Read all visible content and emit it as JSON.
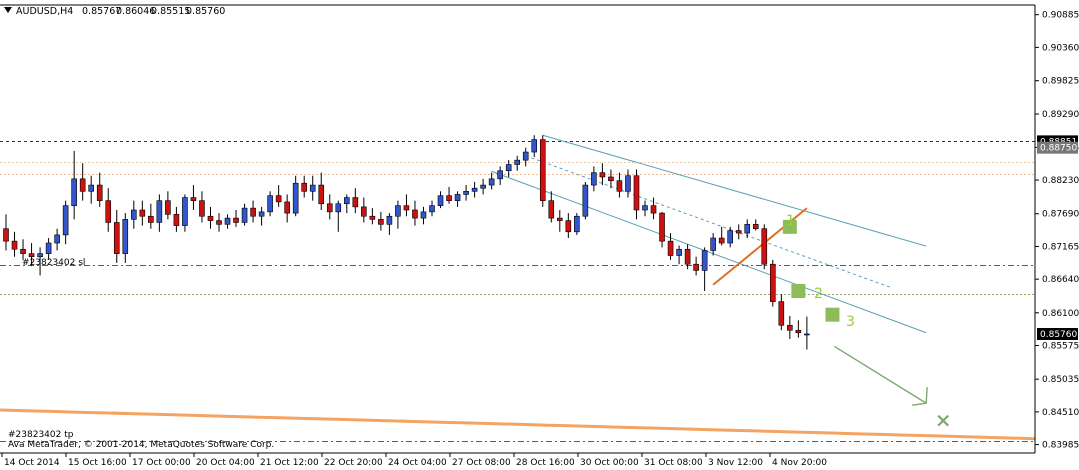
{
  "header": {
    "symbol": "AUDUSD,H4",
    "open": "0.85767",
    "high": "0.86046",
    "low": "0.85515",
    "close": "0.85760"
  },
  "footer": {
    "broker": "Ava MetaTrader, © 2001-2014, MetaQuotes Software Corp."
  },
  "labels": {
    "sl_label": "#23823402 sl",
    "tp_label": "#23823402 tp"
  },
  "annotations": [
    {
      "text": "1"
    },
    {
      "text": "2"
    },
    {
      "text": "3"
    }
  ],
  "colors": {
    "bull": "#3355cc",
    "bear": "#cc1111",
    "resistance": "#990000",
    "sl": "#dd2222",
    "orange": "#f4a460",
    "trendline": "#e07020",
    "channel": "#5aa0b8",
    "green": "#8fbc5a",
    "annotation": "#9acd32"
  },
  "chart_data": {
    "type": "candlestick",
    "y_ticks": [
      "0.90885",
      "0.90360",
      "0.89825",
      "0.89290",
      "0.88755",
      "0.88230",
      "0.87690",
      "0.87165",
      "0.86640",
      "0.86100",
      "0.85575",
      "0.85035",
      "0.84510",
      "0.83985"
    ],
    "x_ticks": [
      "14 Oct 2014",
      "15 Oct 16:00",
      "17 Oct 00:00",
      "20 Oct 04:00",
      "21 Oct 12:00",
      "22 Oct 20:00",
      "24 Oct 04:00",
      "27 Oct 08:00",
      "28 Oct 16:00",
      "30 Oct 00:00",
      "31 Oct 08:00",
      "3 Nov 12:00",
      "4 Nov 20:00"
    ],
    "ylim": [
      0.8385,
      0.9104
    ],
    "price_tags": [
      {
        "label": "0.88851",
        "value": 0.88851,
        "style": "dark"
      },
      {
        "label": "0.88750",
        "value": 0.8875,
        "style": "light"
      },
      {
        "label": "0.85760",
        "value": 0.8576,
        "style": "dark"
      }
    ],
    "levels": [
      {
        "name": "resistance",
        "value": 0.88851
      },
      {
        "name": "stop-loss",
        "value": 0.8687
      },
      {
        "name": "support",
        "value": 0.864
      },
      {
        "name": "take-profit",
        "value": 0.8405
      },
      {
        "name": "upper-reference",
        "value": 0.88525
      },
      {
        "name": "dotted-reference",
        "value": 0.8832
      }
    ],
    "candles": [
      [
        0.8745,
        0.8768,
        0.871,
        0.8725
      ],
      [
        0.8725,
        0.874,
        0.87,
        0.8712
      ],
      [
        0.8712,
        0.8728,
        0.8695,
        0.8705
      ],
      [
        0.8705,
        0.8722,
        0.8685,
        0.87
      ],
      [
        0.87,
        0.8715,
        0.867,
        0.8705
      ],
      [
        0.8705,
        0.873,
        0.8695,
        0.8722
      ],
      [
        0.8722,
        0.8745,
        0.871,
        0.8735
      ],
      [
        0.8735,
        0.879,
        0.872,
        0.8782
      ],
      [
        0.8782,
        0.887,
        0.876,
        0.8825
      ],
      [
        0.8825,
        0.885,
        0.879,
        0.8805
      ],
      [
        0.8805,
        0.883,
        0.8785,
        0.8815
      ],
      [
        0.8815,
        0.8835,
        0.878,
        0.879
      ],
      [
        0.879,
        0.881,
        0.874,
        0.8755
      ],
      [
        0.8755,
        0.8775,
        0.869,
        0.8705
      ],
      [
        0.8705,
        0.877,
        0.869,
        0.876
      ],
      [
        0.876,
        0.879,
        0.8745,
        0.8775
      ],
      [
        0.8775,
        0.879,
        0.875,
        0.8765
      ],
      [
        0.8765,
        0.8785,
        0.8745,
        0.8755
      ],
      [
        0.8755,
        0.88,
        0.874,
        0.879
      ],
      [
        0.879,
        0.8805,
        0.876,
        0.8768
      ],
      [
        0.8768,
        0.878,
        0.874,
        0.875
      ],
      [
        0.875,
        0.88,
        0.874,
        0.8795
      ],
      [
        0.8795,
        0.8815,
        0.8775,
        0.879
      ],
      [
        0.879,
        0.8805,
        0.8755,
        0.8765
      ],
      [
        0.8765,
        0.878,
        0.8745,
        0.8758
      ],
      [
        0.8758,
        0.877,
        0.874,
        0.8752
      ],
      [
        0.8752,
        0.8768,
        0.8745,
        0.8762
      ],
      [
        0.8762,
        0.8775,
        0.8748,
        0.8755
      ],
      [
        0.8755,
        0.8785,
        0.875,
        0.8778
      ],
      [
        0.8778,
        0.879,
        0.8755,
        0.8765
      ],
      [
        0.8765,
        0.878,
        0.875,
        0.8772
      ],
      [
        0.8772,
        0.8805,
        0.8765,
        0.8798
      ],
      [
        0.8798,
        0.8815,
        0.878,
        0.8788
      ],
      [
        0.8788,
        0.88,
        0.8755,
        0.877
      ],
      [
        0.877,
        0.883,
        0.8765,
        0.8818
      ],
      [
        0.8818,
        0.883,
        0.8795,
        0.8805
      ],
      [
        0.8805,
        0.883,
        0.879,
        0.8815
      ],
      [
        0.8815,
        0.8835,
        0.8775,
        0.8785
      ],
      [
        0.8785,
        0.88,
        0.876,
        0.8772
      ],
      [
        0.8772,
        0.879,
        0.874,
        0.8785
      ],
      [
        0.8785,
        0.88,
        0.877,
        0.8795
      ],
      [
        0.8795,
        0.881,
        0.877,
        0.878
      ],
      [
        0.878,
        0.8795,
        0.8755,
        0.8765
      ],
      [
        0.8765,
        0.8778,
        0.8752,
        0.876
      ],
      [
        0.876,
        0.8772,
        0.8742,
        0.8752
      ],
      [
        0.8752,
        0.877,
        0.8735,
        0.8765
      ],
      [
        0.8765,
        0.879,
        0.8745,
        0.8782
      ],
      [
        0.8782,
        0.88,
        0.8765,
        0.8775
      ],
      [
        0.8775,
        0.879,
        0.875,
        0.8762
      ],
      [
        0.8762,
        0.878,
        0.8752,
        0.8772
      ],
      [
        0.8772,
        0.879,
        0.8765,
        0.8782
      ],
      [
        0.8782,
        0.8805,
        0.8778,
        0.8798
      ],
      [
        0.8798,
        0.8812,
        0.8785,
        0.879
      ],
      [
        0.879,
        0.8805,
        0.878,
        0.88
      ],
      [
        0.88,
        0.8815,
        0.879,
        0.8805
      ],
      [
        0.8805,
        0.882,
        0.8795,
        0.881
      ],
      [
        0.881,
        0.8825,
        0.88,
        0.8815
      ],
      [
        0.8815,
        0.8835,
        0.8808,
        0.8825
      ],
      [
        0.8825,
        0.8845,
        0.8815,
        0.8838
      ],
      [
        0.8838,
        0.8855,
        0.8828,
        0.8848
      ],
      [
        0.8848,
        0.8862,
        0.8838,
        0.8855
      ],
      [
        0.8855,
        0.8875,
        0.8845,
        0.8868
      ],
      [
        0.8868,
        0.8895,
        0.886,
        0.8888
      ],
      [
        0.8888,
        0.8895,
        0.878,
        0.879
      ],
      [
        0.879,
        0.8805,
        0.8755,
        0.8762
      ],
      [
        0.8762,
        0.8775,
        0.874,
        0.8758
      ],
      [
        0.8758,
        0.877,
        0.873,
        0.874
      ],
      [
        0.874,
        0.877,
        0.8735,
        0.8765
      ],
      [
        0.8765,
        0.882,
        0.876,
        0.8815
      ],
      [
        0.8815,
        0.8845,
        0.8805,
        0.8835
      ],
      [
        0.8835,
        0.885,
        0.8815,
        0.8828
      ],
      [
        0.8828,
        0.884,
        0.881,
        0.8822
      ],
      [
        0.8822,
        0.8835,
        0.8795,
        0.8805
      ],
      [
        0.8805,
        0.884,
        0.8795,
        0.883
      ],
      [
        0.883,
        0.884,
        0.876,
        0.8775
      ],
      [
        0.8775,
        0.879,
        0.8765,
        0.8782
      ],
      [
        0.8782,
        0.8795,
        0.876,
        0.877
      ],
      [
        0.877,
        0.8772,
        0.8715,
        0.8725
      ],
      [
        0.8725,
        0.8738,
        0.8695,
        0.8702
      ],
      [
        0.8702,
        0.8718,
        0.8688,
        0.8712
      ],
      [
        0.8712,
        0.872,
        0.868,
        0.8688
      ],
      [
        0.8688,
        0.87,
        0.867,
        0.8678
      ],
      [
        0.8678,
        0.8715,
        0.8645,
        0.871
      ],
      [
        0.871,
        0.8738,
        0.8702,
        0.873
      ],
      [
        0.873,
        0.8748,
        0.8718,
        0.8722
      ],
      [
        0.8722,
        0.8748,
        0.8715,
        0.8742
      ],
      [
        0.8742,
        0.8752,
        0.8728,
        0.8738
      ],
      [
        0.8738,
        0.876,
        0.873,
        0.8752
      ],
      [
        0.8752,
        0.876,
        0.8742,
        0.8745
      ],
      [
        0.8745,
        0.8752,
        0.868,
        0.8688
      ],
      [
        0.8688,
        0.8695,
        0.862,
        0.8628
      ],
      [
        0.8628,
        0.864,
        0.8582,
        0.859
      ],
      [
        0.859,
        0.8605,
        0.8568,
        0.8582
      ],
      [
        0.8582,
        0.8598,
        0.857,
        0.8578
      ],
      [
        0.8576,
        0.8604,
        0.8551,
        0.8576
      ]
    ]
  }
}
